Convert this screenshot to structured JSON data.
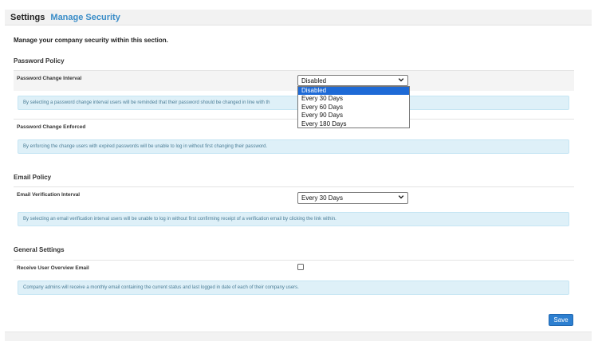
{
  "breadcrumb": {
    "root": "Settings",
    "page": "Manage Security"
  },
  "intro": "Manage your company security within this section.",
  "password_policy": {
    "title": "Password Policy",
    "change_interval": {
      "label": "Password Change Interval",
      "value": "Disabled",
      "options": [
        "Disabled",
        "Every 30 Days",
        "Every 60 Days",
        "Every 90 Days",
        "Every 180 Days"
      ],
      "selected_option": "Disabled",
      "help": "By selecting a password change interval users will be reminded that their password should be changed in line with th"
    },
    "change_enforced": {
      "label": "Password Change Enforced",
      "help": "By enforcing the change users with expired passwords will be unable to log in without first changing their password."
    }
  },
  "email_policy": {
    "title": "Email Policy",
    "verification_interval": {
      "label": "Email Verification Interval",
      "value": "Every 30 Days",
      "help": "By selecting an email verification interval users will be unable to log in without first confirming receipt of a verification email by clicking the link within."
    }
  },
  "general_settings": {
    "title": "General Settings",
    "overview_email": {
      "label": "Receive User Overview Email",
      "checked": false,
      "help": "Company admins will receive a monthly email containing the current status and last logged in date of each of their company users."
    }
  },
  "actions": {
    "save_label": "Save"
  },
  "colors": {
    "accent": "#3a8dc8",
    "button": "#2d7fd0",
    "info_bg": "#def0f8",
    "option_highlight": "#1e6ad6"
  }
}
